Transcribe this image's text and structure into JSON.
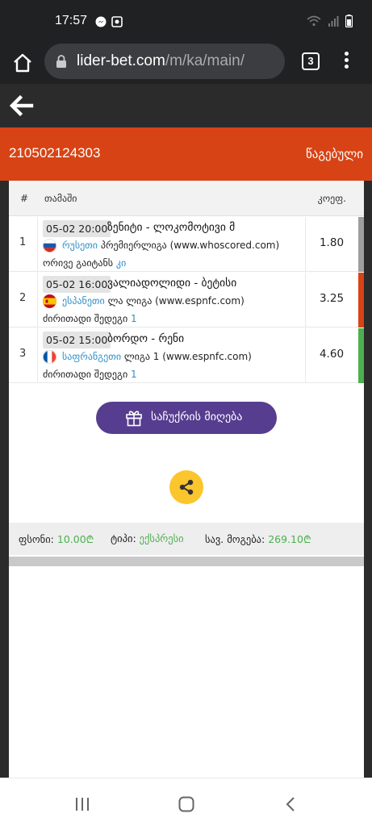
{
  "status_bar": {
    "time": "17:57"
  },
  "browser": {
    "url_host": "lider-bet.com",
    "url_path": "/m/ka/main/",
    "tab_count": "3"
  },
  "ticket": {
    "id": "210502124303",
    "status": "წაგებული"
  },
  "table": {
    "headers": {
      "num": "#",
      "game": "თამაში",
      "coef": "კოეფ."
    },
    "rows": [
      {
        "num": "1",
        "date": "05-02 20:00",
        "match": "ზენიტი - ლოკომოტივი მ",
        "country": "რუსეთი",
        "league": "პრემიერლიგა (www.whoscored.com)",
        "market": "ორივე გაიტანს",
        "pick": "კი",
        "coef": "1.80",
        "stripe_color": "#9e9e9e",
        "flag": "russia"
      },
      {
        "num": "2",
        "date": "05-02 16:00",
        "match": "ვალიადოლიდი - ბეტისი",
        "country": "ესპანეთი",
        "league": "ლა ლიგა (www.espnfc.com)",
        "market": "ძირითადი შედეგი",
        "pick": "1",
        "coef": "3.25",
        "stripe_color": "#d84315",
        "flag": "spain"
      },
      {
        "num": "3",
        "date": "05-02 15:00",
        "match": "ბორდო - რენი",
        "country": "საფრანგეთი",
        "league": "ლიგა 1 (www.espnfc.com)",
        "market": "ძირითადი შედეგი",
        "pick": "1",
        "coef": "4.60",
        "stripe_color": "#4caf50",
        "flag": "france"
      }
    ]
  },
  "gift_button": {
    "label": "საჩუქრის მიღება",
    "icon": "gift-icon",
    "color": "#563d8f"
  },
  "share_button": {
    "icon": "share-icon",
    "color": "#fbc52d"
  },
  "summary": {
    "stake_label": "ფსონი:",
    "stake_value": "10.00₾",
    "type_label": "ტიპი:",
    "type_value": "ექსპრესი",
    "win_label": "სავ. მოგება:",
    "win_value": "269.10₾"
  },
  "colors": {
    "accent": "#d84315",
    "link": "#2f8fc8",
    "positive": "#4caf50"
  }
}
